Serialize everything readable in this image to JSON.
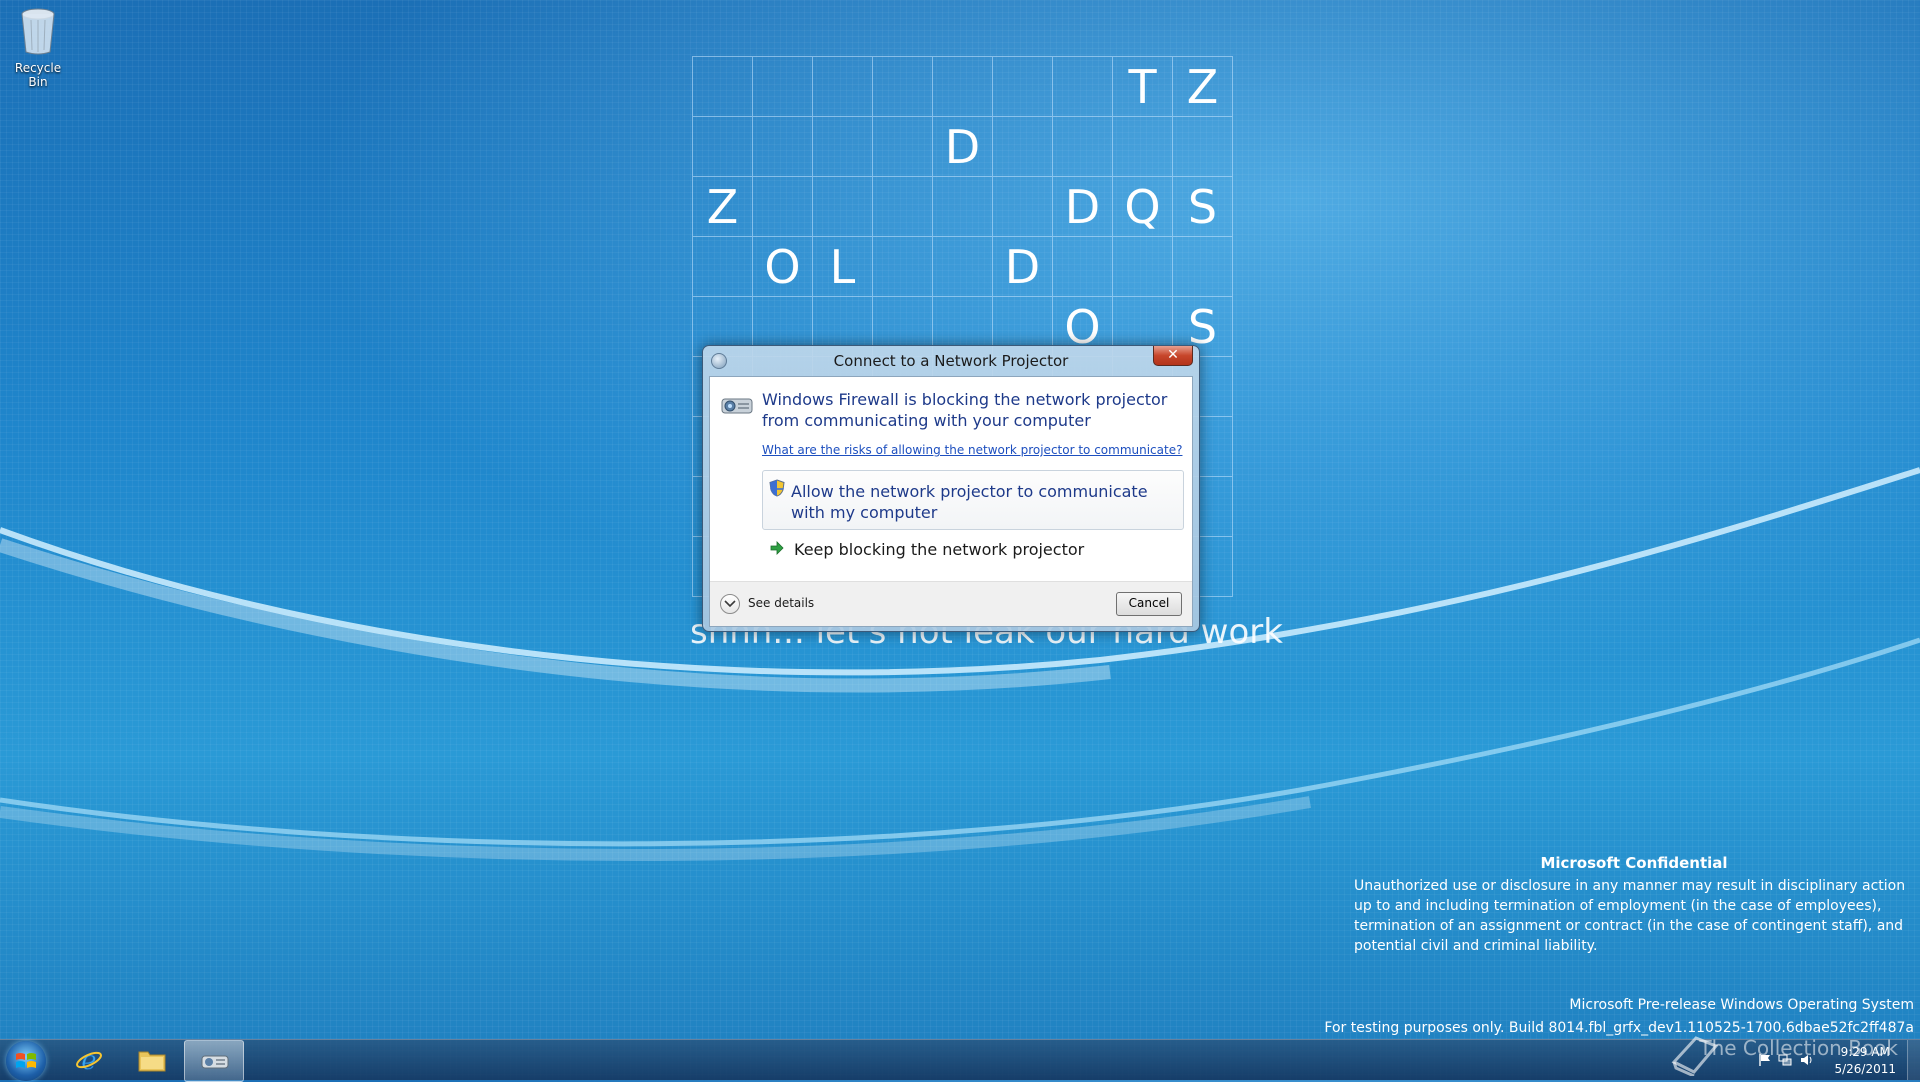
{
  "desktop": {
    "recycle_bin_label": "Recycle Bin",
    "grid_rows": [
      [
        "",
        "",
        "",
        "",
        "",
        "",
        "",
        "T",
        "Z"
      ],
      [
        "",
        "",
        "",
        "",
        "D",
        "",
        "",
        "",
        ""
      ],
      [
        "Z",
        "",
        "",
        "",
        "",
        "",
        "D",
        "Q",
        "S"
      ],
      [
        "",
        "O",
        "L",
        "",
        "",
        "D",
        "",
        "",
        ""
      ],
      [
        "",
        "",
        "",
        "",
        "",
        "",
        "O",
        "",
        "S"
      ],
      [
        "",
        "",
        "",
        "",
        "",
        "",
        "",
        "",
        ""
      ],
      [
        "",
        "",
        "",
        "",
        "",
        "",
        "",
        "",
        ""
      ],
      [
        "",
        "",
        "",
        "",
        "",
        "",
        "",
        "",
        ""
      ],
      [
        "",
        "",
        "",
        "",
        "",
        "",
        "",
        "",
        ""
      ]
    ],
    "tagline": "shhh... let's not leak our hard work"
  },
  "dialog": {
    "title": "Connect to a Network Projector",
    "close_glyph": "✕",
    "main_instruction": "Windows Firewall is blocking the network projector from communicating with your computer",
    "help_link": "What are the risks of allowing the network projector to communicate?",
    "allow_label": "Allow the network projector to communicate with my computer",
    "keep_label": "Keep blocking the network projector",
    "see_details": "See details",
    "cancel": "Cancel"
  },
  "watermark": {
    "title": "Microsoft Confidential",
    "body": "Unauthorized use or disclosure in any manner may result in disciplinary action up to and including termination of employment (in the case of employees), termination of an assignment or contract (in the case of contingent staff), and potential civil and criminal liability.",
    "os": "Microsoft Pre-release Windows Operating System",
    "build": "For testing purposes only. Build 8014.fbl_grfx_dev1.110525-1700.6dbae52fc2ff487a"
  },
  "taskbar": {
    "time": "9:29 AM",
    "date": "5/26/2011",
    "overlay_brand": "The Collection Book"
  },
  "colors": {
    "accent_link": "#1d4fbf",
    "instruction_text": "#1e3a8a",
    "close_red": "#c7462b"
  },
  "icons": [
    "recycle-bin-icon",
    "projector-icon",
    "shield-icon",
    "green-arrow-icon",
    "chevron-down-icon",
    "start-orb-icon",
    "internet-explorer-icon",
    "folder-icon",
    "network-projector-icon",
    "flag-icon",
    "network-icon",
    "speaker-icon"
  ]
}
